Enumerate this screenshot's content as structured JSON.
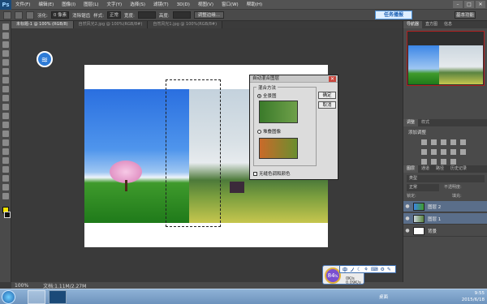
{
  "app": {
    "logo": "Ps"
  },
  "menu": [
    "文件(F)",
    "编辑(E)",
    "图像(I)",
    "图层(L)",
    "文字(Y)",
    "选择(S)",
    "滤镜(T)",
    "3D(D)",
    "视图(V)",
    "窗口(W)",
    "帮助(H)"
  ],
  "window_controls": [
    "–",
    "□",
    "✕"
  ],
  "options": {
    "feather_label": "羽化:",
    "feather_value": "0 像素",
    "antialias": "消除锯齿",
    "style_label": "样式:",
    "style_value": "正常",
    "width_label": "宽度:",
    "height_label": "高度:",
    "refine_button": "调整边缘...",
    "badge": "任务播报",
    "workspace": "基本功能"
  },
  "tabs": [
    "未标题-1 @ 100% (RGB/8)",
    "自然风光2.jpg @ 100%(RGB/8#)",
    "自然风光1.jpg @ 100%(RGB/8#)"
  ],
  "dialog": {
    "title": "自动混合图层",
    "close": "✕",
    "group_label": "混合方法",
    "option1": "全景图",
    "option2": "堆叠图像",
    "checkbox": "无缝色调和颜色",
    "ok": "确定",
    "cancel": "取消"
  },
  "panels": {
    "top_tabs": [
      "导航器",
      "直方图",
      "信息"
    ],
    "adjust_tabs": [
      "调整",
      "样式"
    ],
    "adjust_title": "添加调整",
    "layers_tabs": [
      "图层",
      "通道",
      "路径",
      "历史记录"
    ],
    "kind_label": "类型",
    "blend_mode": "正常",
    "opacity_label": "不透明度:",
    "fill_label": "填充:",
    "lock_label": "锁定:",
    "layers": [
      {
        "name": "图层 2",
        "selected": true
      },
      {
        "name": "图层 1",
        "selected": true
      },
      {
        "name": "背景",
        "selected": false
      }
    ]
  },
  "status": {
    "zoom": "100%",
    "doc": "文档:1.11M/2.27M"
  },
  "taskbar": {
    "tray": "桌面",
    "time": "9:55",
    "date": "2015/6/18"
  },
  "perf": {
    "value": "84",
    "unit": "%",
    "line1": "0K/s",
    "line2": "0.09K/s"
  },
  "ime": [
    "中",
    "ノ",
    "☾",
    "⚘",
    "⌨",
    "⚙",
    "✎"
  ]
}
